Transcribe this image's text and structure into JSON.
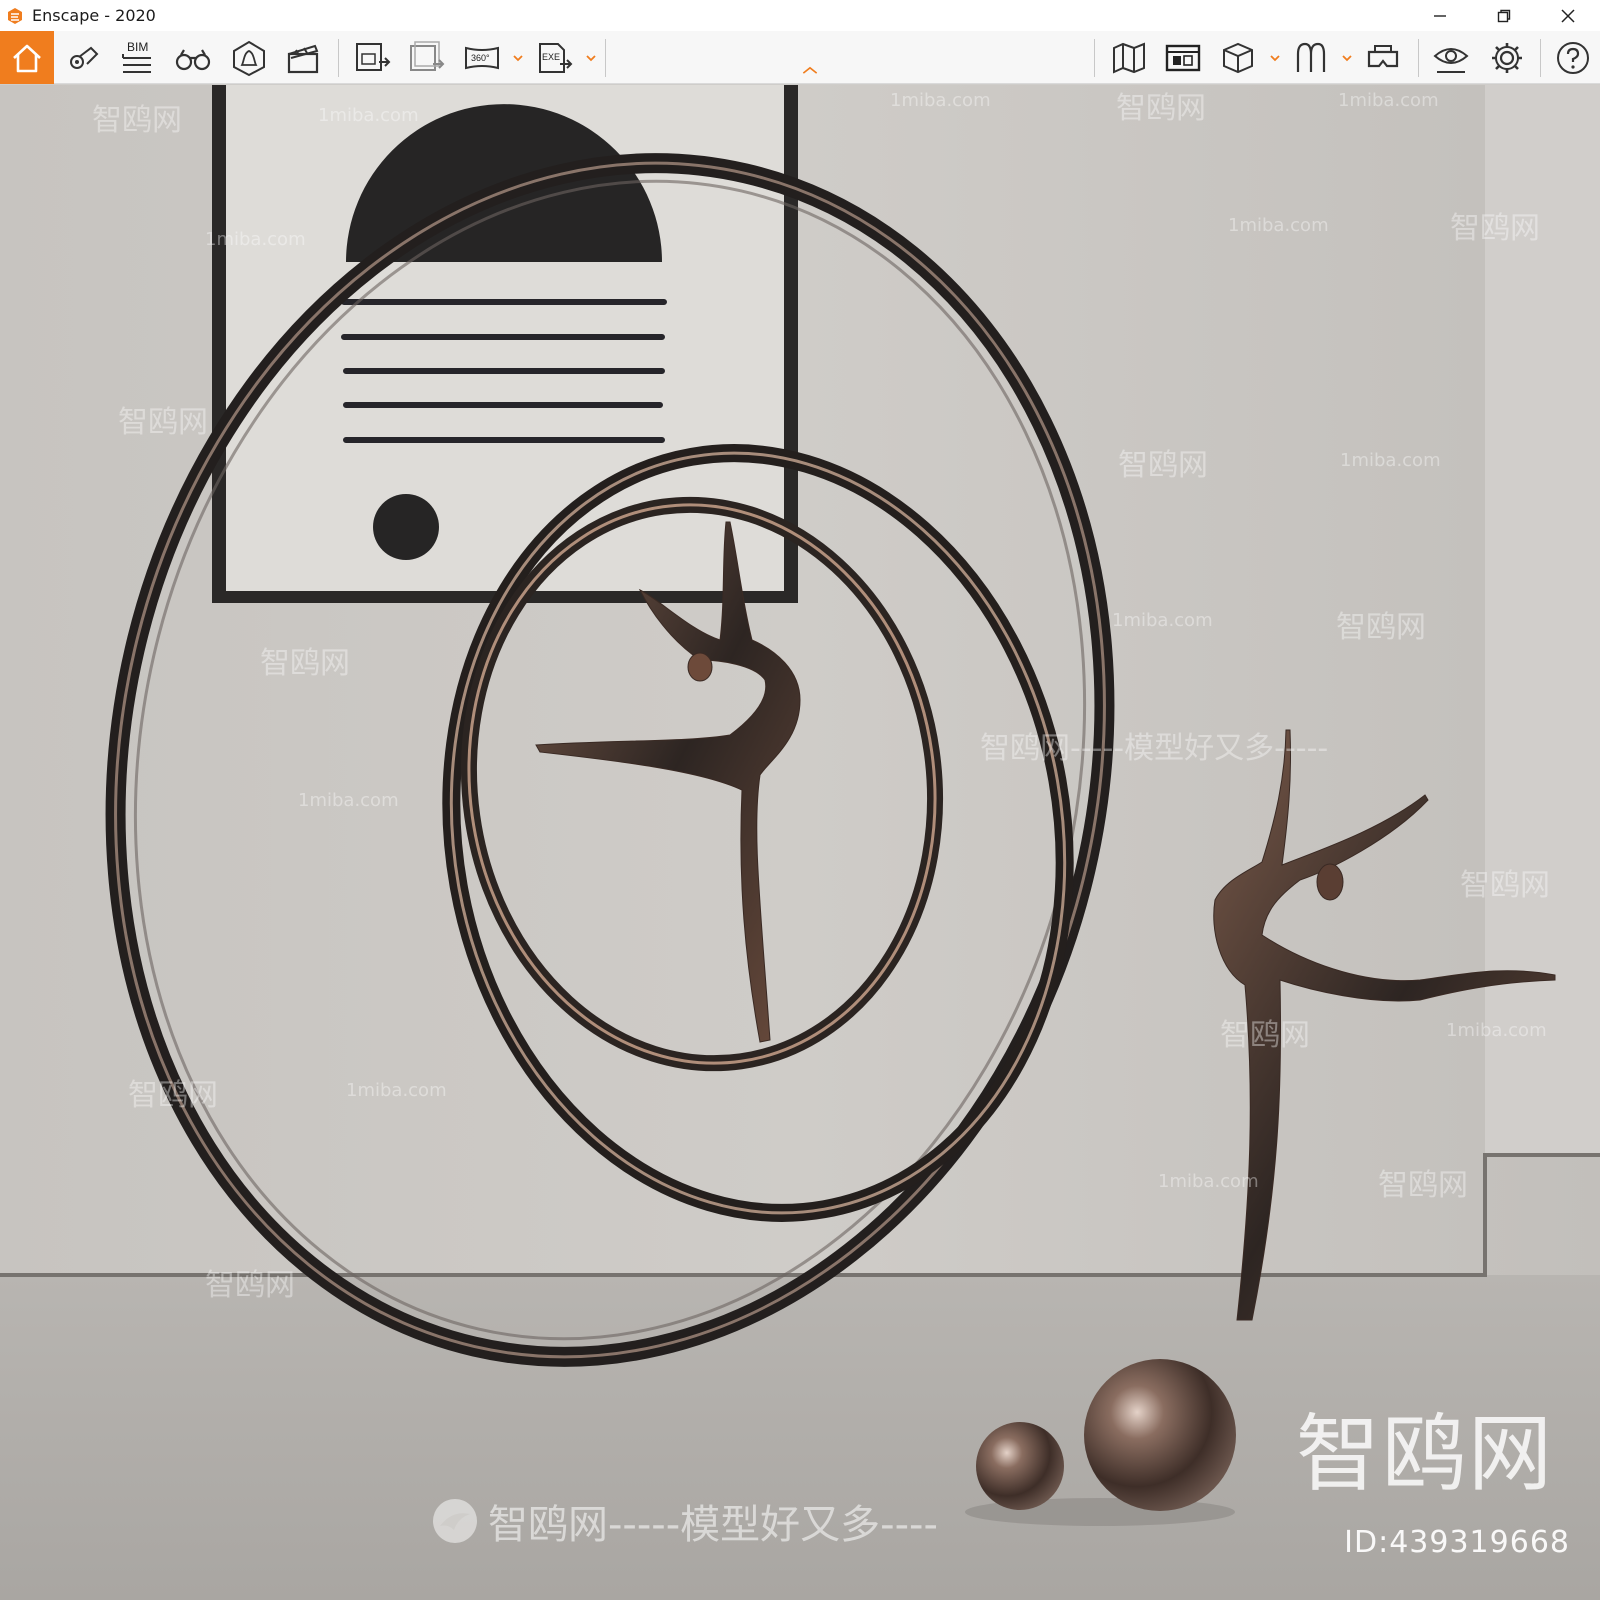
{
  "window": {
    "title": "Enscape - 2020",
    "accent_color": "#f07d1e"
  },
  "toolbar": {
    "bim_label": "BIM",
    "icons": [
      "home-icon",
      "location-pin-icon",
      "bim-icon",
      "binoculars-icon",
      "warning-bell-icon",
      "clapperboard-icon",
      "export-image-icon",
      "batch-render-icon",
      "panorama-360-icon",
      "export-exe-icon",
      "map-icon",
      "asset-library-icon",
      "cube-view-icon",
      "material-editor-icon",
      "vr-headset-icon",
      "visual-settings-icon",
      "gear-icon",
      "help-icon"
    ],
    "panorama_label": "360°",
    "exe_label": "EXE"
  },
  "viewport": {
    "watermark_brand": "智鸥网",
    "watermark_id": "ID:439319668",
    "watermark_slogan": "智鸥网-----模型好又多----",
    "watermark_site": "1miba.com",
    "watermark_small_cn": "智鸥网",
    "watermark_tagline_cn": "智鸥网-----模型好又多-----"
  }
}
